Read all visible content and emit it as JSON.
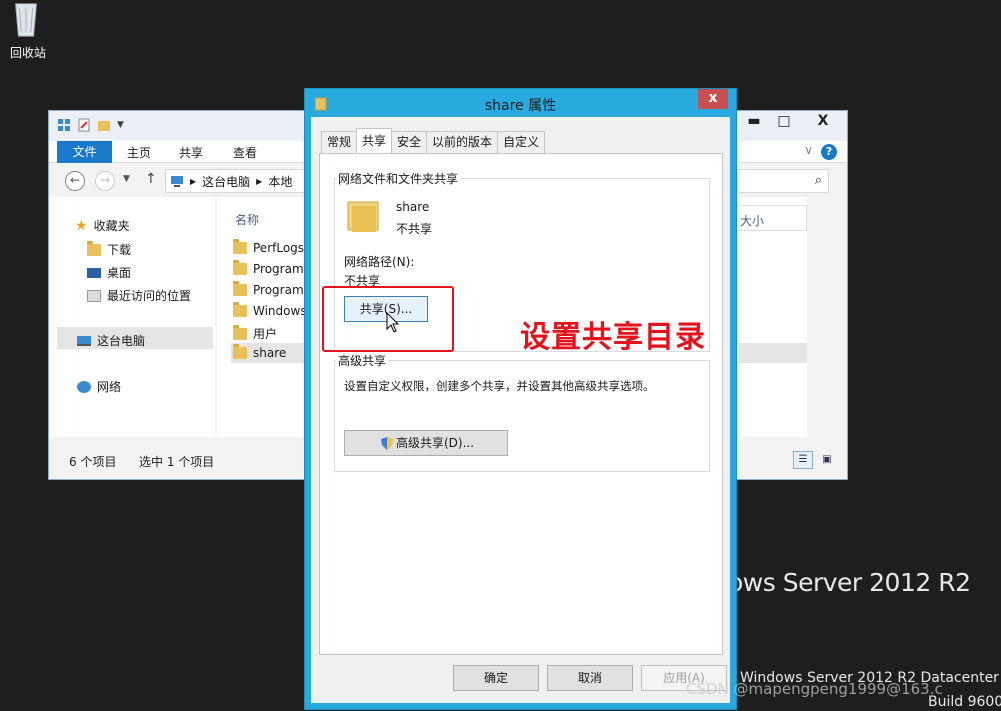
{
  "desktop": {
    "recycle_bin_label": "回收站",
    "brand_line1": "ows Server 2012 R2",
    "brand_line2": "Windows Server 2012 R2 Datacenter",
    "brand_line3": "Build 9600",
    "csdn_watermark": "CSDN @mapengpeng1999@163.c"
  },
  "explorer": {
    "ribbon_tabs": [
      "文件",
      "主页",
      "共享",
      "查看"
    ],
    "address_segments": [
      "这台电脑",
      "本地"
    ],
    "nav_pane": {
      "favorites": "收藏夹",
      "downloads": "下载",
      "desktop": "桌面",
      "recent": "最近访问的位置",
      "this_pc": "这台电脑",
      "network": "网络"
    },
    "column_name": "名称",
    "column_size": "大小",
    "files": [
      "PerfLogs",
      "Program",
      "Program",
      "Windows",
      "用户",
      "share"
    ],
    "status_count": "6 个项目",
    "status_selected": "选中 1 个项目",
    "controls": {
      "minimize": "▬",
      "maximize": "□",
      "close": "X"
    }
  },
  "dialog": {
    "title": "share 属性",
    "close": "x",
    "tabs": [
      "常规",
      "共享",
      "安全",
      "以前的版本",
      "自定义"
    ],
    "active_tab": "共享",
    "network_group_label": "网络文件和文件夹共享",
    "folder_name": "share",
    "share_state": "不共享",
    "network_path_label": "网络路径(N):",
    "network_path_value": "不共享",
    "share_button": "共享(S)...",
    "advanced_group_label": "高级共享",
    "advanced_desc": "设置自定义权限，创建多个共享，并设置其他高级共享选项。",
    "advanced_button": "高级共享(D)...",
    "ok_button": "确定",
    "cancel_button": "取消",
    "apply_button": "应用(A)"
  },
  "annotation": {
    "text": "设置共享目录",
    "color": "#e5121c"
  },
  "colors": {
    "dialog_frame": "#29aadf",
    "file_tab": "#1979ca",
    "desktop": "#1e1e1e"
  }
}
